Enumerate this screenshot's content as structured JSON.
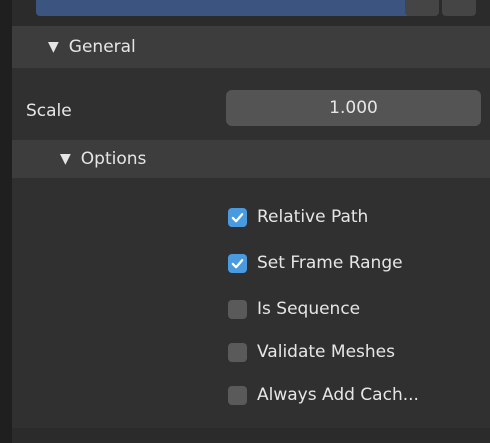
{
  "panel": {
    "general_label": "General",
    "options_label": "Options"
  },
  "scale": {
    "label": "Scale",
    "value": "1.000"
  },
  "options": [
    {
      "label": "Relative Path",
      "checked": true
    },
    {
      "label": "Set Frame Range",
      "checked": true
    },
    {
      "label": "Is Sequence",
      "checked": false
    },
    {
      "label": "Validate Meshes",
      "checked": false
    },
    {
      "label": "Always Add Cach...",
      "checked": false
    }
  ],
  "colors": {
    "checkbox_on": "#4a9ae0",
    "checkbox_off": "#5a5a5a",
    "header_bg": "#3d3d3d",
    "panel_bg": "#303030"
  }
}
